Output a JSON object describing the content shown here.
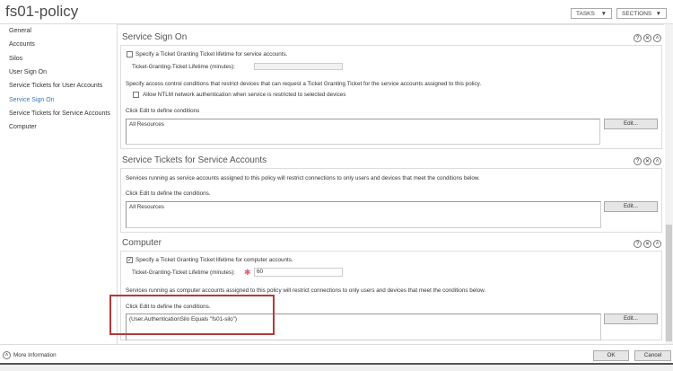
{
  "title": "fs01-policy",
  "header": {
    "tasks": "TASKS",
    "sections": "SECTIONS"
  },
  "nav": [
    "General",
    "Accounts",
    "Silos",
    "User Sign On",
    "Service Tickets for User Accounts",
    "Service Sign On",
    "Service Tickets for Service Accounts",
    "Computer"
  ],
  "selected_nav": "Service Sign On",
  "service_sign_on": {
    "heading": "Service Sign On",
    "tgt_checkbox": "Specify a Ticket Granting Ticket lifetime for service accounts.",
    "tgt_checked": false,
    "lifetime_label": "Ticket-Granting-Ticket Lifetime (minutes):",
    "lifetime_value": "",
    "access_text": "Specify access control conditions that restrict devices that can request a Ticket Granting Ticket for the service accounts assigned to this policy.",
    "ntlm_checkbox": "Allow NTLM network authentication when service is restricted to selected devices",
    "ntlm_checked": false,
    "edit_prompt": "Click Edit to define conditions",
    "conditions": "All Resources",
    "edit": "Edit..."
  },
  "service_tickets_service": {
    "heading": "Service Tickets for Service Accounts",
    "desc": "Services running as service accounts assigned to this policy will restrict connections to only users and devices that meet the conditions below.",
    "edit_prompt": "Click Edit to define the conditions.",
    "conditions": "All Resources",
    "edit": "Edit..."
  },
  "computer": {
    "heading": "Computer",
    "tgt_checkbox": "Specify a Ticket Granting Ticket lifetime for computer accounts.",
    "tgt_checked": true,
    "check_mark": "✓",
    "lifetime_label": "Ticket-Granting-Ticket Lifetime (minutes):",
    "required_mark": "✱",
    "lifetime_value": "60",
    "desc": "Services running as computer accounts assigned to this policy will restrict connections to only users and devices that meet the conditions below.",
    "edit_prompt": "Click Edit to define the conditions.",
    "conditions": "(User.AuthenticationSilo Equals \"fs01-silo\")",
    "edit": "Edit..."
  },
  "section_icons": {
    "help": "?",
    "close": "✕",
    "collapse": "˄"
  },
  "footer": {
    "more_info": "More Information",
    "ok": "OK",
    "cancel": "Cancel"
  },
  "colors": {
    "highlight": "#b33a3a",
    "selected_nav": "#3a78b5"
  }
}
